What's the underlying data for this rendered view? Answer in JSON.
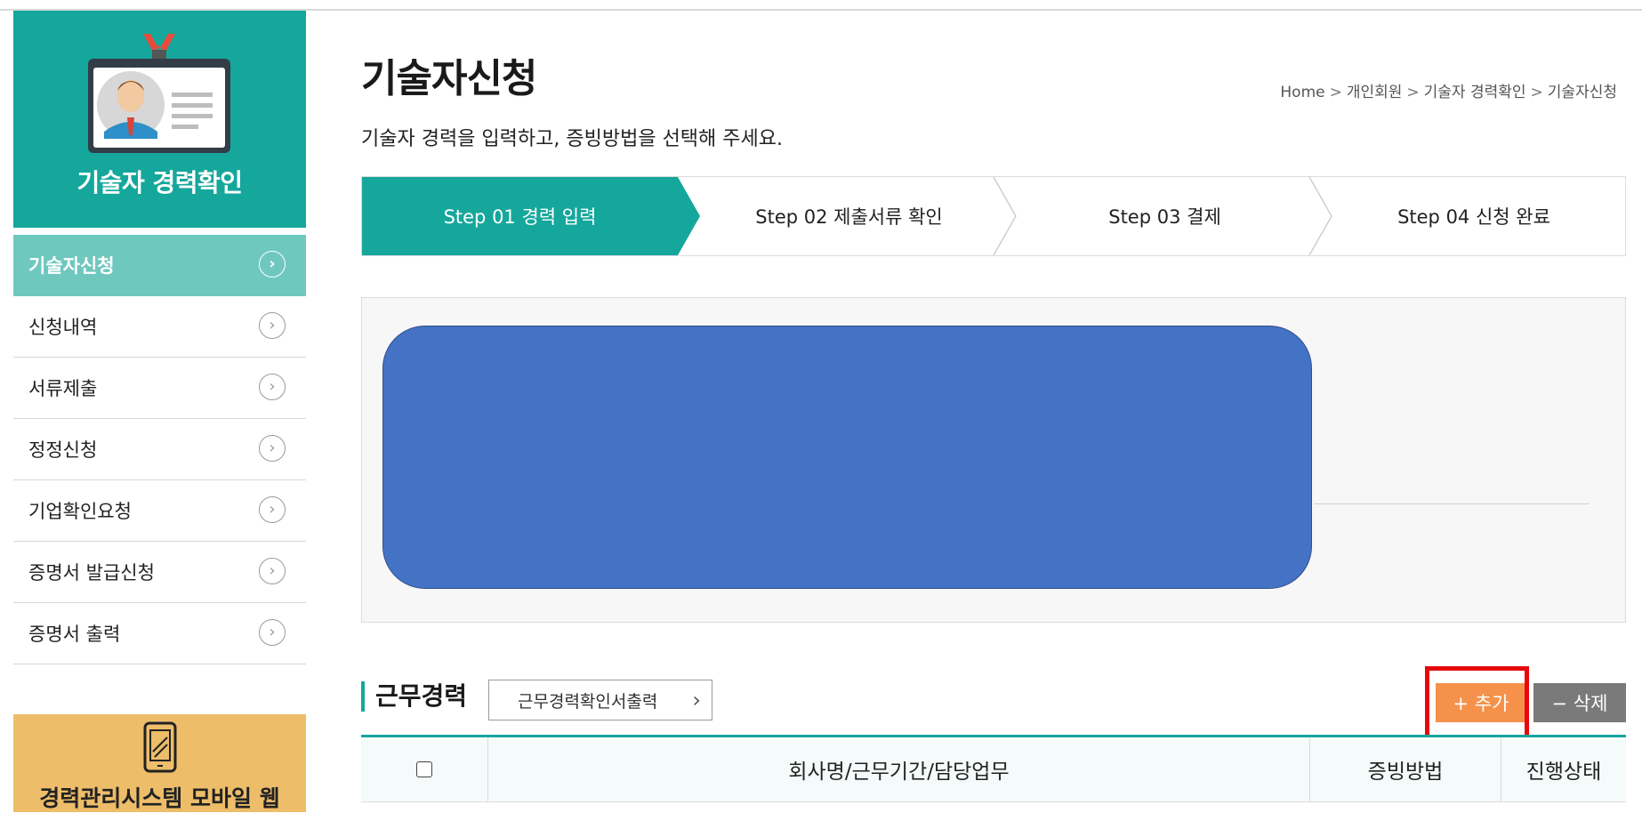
{
  "sidebar": {
    "title": "기술자 경력확인",
    "items": [
      {
        "label": "기술자신청",
        "active": true
      },
      {
        "label": "신청내역",
        "active": false
      },
      {
        "label": "서류제출",
        "active": false
      },
      {
        "label": "정정신청",
        "active": false
      },
      {
        "label": "기업확인요청",
        "active": false
      },
      {
        "label": "증명서 발급신청",
        "active": false
      },
      {
        "label": "증명서 출력",
        "active": false
      }
    ],
    "arrow_glyph": "›",
    "mobile_banner": "경력관리시스템 모바일 웹"
  },
  "header": {
    "title": "기술자신청",
    "subtitle": "기술자 경력을 입력하고, 증빙방법을 선택해 주세요.",
    "breadcrumb": [
      "Home",
      "개인회원",
      "기술자 경력확인",
      "기술자신청"
    ],
    "breadcrumb_sep": ">"
  },
  "steps": [
    {
      "label": "Step 01 경력 입력",
      "active": true
    },
    {
      "label": "Step 02 제출서류 확인",
      "active": false
    },
    {
      "label": "Step 03 결제",
      "active": false
    },
    {
      "label": "Step 04 신청 완료",
      "active": false
    }
  ],
  "career": {
    "section_title": "근무경력",
    "print_button": "근무경력확인서출력",
    "print_chevron": "›",
    "add_button": "+ 추가",
    "delete_button": "− 삭제",
    "columns": [
      "회사명/근무기간/담당업무",
      "증빙방법",
      "진행상태"
    ]
  },
  "colors": {
    "accent": "#15a79b",
    "active_menu": "#6fc8be",
    "add_button": "#f5914b",
    "delete_button": "#7a7a7a",
    "mobile_banner": "#edbd69",
    "redaction": "#4472c4",
    "highlight": "#e8080b"
  }
}
